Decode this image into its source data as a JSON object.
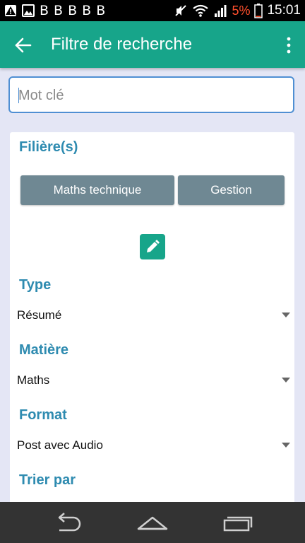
{
  "status_bar": {
    "left_icons": [
      "warning-icon",
      "image-icon"
    ],
    "b_icons": [
      "B",
      "B",
      "B",
      "B",
      "B"
    ],
    "battery_percent": "5%",
    "time": "15:01"
  },
  "app_bar": {
    "title": "Filtre de recherche"
  },
  "search": {
    "placeholder": "Mot clé",
    "value": ""
  },
  "filieres": {
    "title": "Filière(s)",
    "chips": [
      "Maths technique",
      "Gestion"
    ]
  },
  "type": {
    "title": "Type",
    "selected": "Résumé"
  },
  "matiere": {
    "title": "Matière",
    "selected": "Maths"
  },
  "format": {
    "title": "Format",
    "selected": "Post avec Audio"
  },
  "trier": {
    "title": "Trier par"
  },
  "colors": {
    "accent": "#17a58a",
    "section_title": "#2e8bb0",
    "chip": "#6f8893",
    "background": "#e4e6f5",
    "battery_low": "#ff4f2c"
  }
}
